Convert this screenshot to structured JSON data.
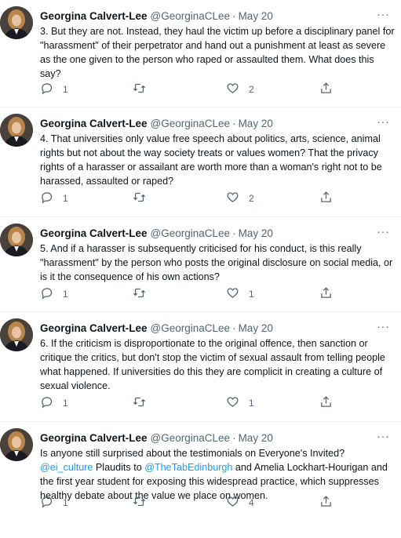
{
  "tweets": [
    {
      "name": "Georgina Calvert-Lee",
      "handle": "@GeorginaCLee",
      "dot": "·",
      "date": "May 20",
      "more": "···",
      "text": "3. But they are not. Instead, they haul the victim up before a disciplinary panel for \"harassment\" of their perpetrator and hand out a punishment at least as severe as the one given to the person who raped or assaulted them. What does this say?",
      "replies": "1",
      "retweets": "",
      "likes": "2"
    },
    {
      "name": "Georgina Calvert-Lee",
      "handle": "@GeorginaCLee",
      "dot": "·",
      "date": "May 20",
      "more": "···",
      "text": "4. That universities only value free speech about politics, arts, science, animal rights but not about the way society treats or values women? That the privacy rights of a harasser or assailant are worth more than a woman's right not to be harassed, assaulted or raped?",
      "replies": "1",
      "retweets": "",
      "likes": "2"
    },
    {
      "name": "Georgina Calvert-Lee",
      "handle": "@GeorginaCLee",
      "dot": "·",
      "date": "May 20",
      "more": "···",
      "text": "5. And if a harasser is subsequently criticised for his conduct, is this really \"harassment\" by the person who posts the original disclosure on social media, or is it the consequence of his own actions?",
      "replies": "1",
      "retweets": "",
      "likes": "1"
    },
    {
      "name": "Georgina Calvert-Lee",
      "handle": "@GeorginaCLee",
      "dot": "·",
      "date": "May 20",
      "more": "···",
      "text": "6. If the criticism is disproportionate to the original offence, then sanction or critique the critics, but don't stop the victim of sexual assault from telling people what happened. If universities do this they are complicit in creating a culture of sexual violence.",
      "replies": "1",
      "retweets": "",
      "likes": "1"
    },
    {
      "name": "Georgina Calvert-Lee",
      "handle": "@GeorginaCLee",
      "dot": "·",
      "date": "May 20",
      "more": "···",
      "text_parts": {
        "t1": "Is anyone still surprised about the testimonials on Everyone's Invited? ",
        "link1": "@ei_culture",
        "t2": "  Plaudits to ",
        "link2": "@TheTabEdinburgh",
        "t3": " and Amelia Lockhart-Hourigan and the first year student for exposing this widespread practice, which suppresses healthy debate about the value we place on women."
      },
      "replies": "1",
      "retweets": "",
      "likes": "4"
    }
  ],
  "colors": {
    "text": "#0f1419",
    "muted": "#536471",
    "link": "#1d9bf0"
  },
  "icons": [
    "reply-icon",
    "retweet-icon",
    "like-icon",
    "share-icon",
    "more-icon"
  ]
}
